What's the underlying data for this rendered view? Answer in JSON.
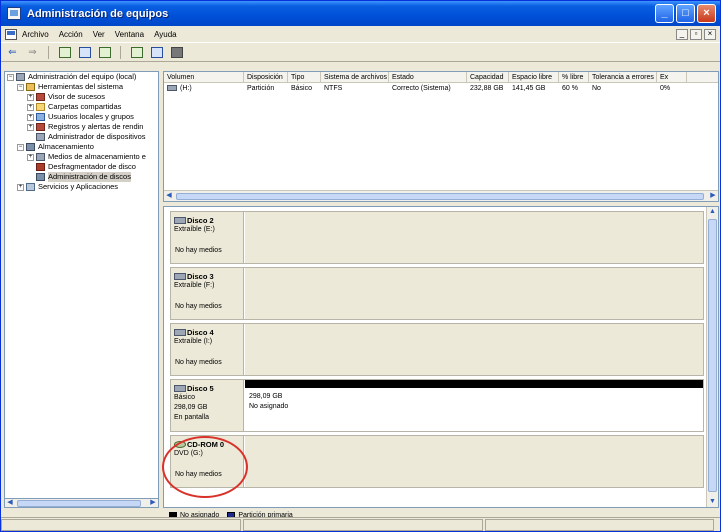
{
  "window": {
    "title": "Administración de equipos"
  },
  "menu": [
    "Archivo",
    "Acción",
    "Ver",
    "Ventana",
    "Ayuda"
  ],
  "mdi": {
    "minimize": "_",
    "restore": "▫",
    "close": "×"
  },
  "tree": {
    "items": [
      {
        "label": "Administración del equipo (local)",
        "expander": "−",
        "indent": 0,
        "icon": "computer-icon"
      },
      {
        "label": "Herramientas del sistema",
        "expander": "−",
        "indent": 1,
        "icon": "tools-icon"
      },
      {
        "label": "Visor de sucesos",
        "expander": "+",
        "indent": 2,
        "icon": "event-viewer-icon"
      },
      {
        "label": "Carpetas compartidas",
        "expander": "+",
        "indent": 2,
        "icon": "shared-folder-icon"
      },
      {
        "label": "Usuarios locales y grupos",
        "expander": "+",
        "indent": 2,
        "icon": "users-icon"
      },
      {
        "label": "Registros y alertas de rendin",
        "expander": "+",
        "indent": 2,
        "icon": "performance-logs-icon"
      },
      {
        "label": "Administrador de dispositivos",
        "expander": "",
        "indent": 2,
        "icon": "device-manager-icon"
      },
      {
        "label": "Almacenamiento",
        "expander": "−",
        "indent": 1,
        "icon": "storage-icon"
      },
      {
        "label": "Medios de almacenamiento e",
        "expander": "+",
        "indent": 2,
        "icon": "removable-storage-icon"
      },
      {
        "label": "Desfragmentador de disco",
        "expander": "",
        "indent": 2,
        "icon": "defrag-icon"
      },
      {
        "label": "Administración de discos",
        "expander": "",
        "indent": 2,
        "icon": "disk-management-icon",
        "selected": true
      },
      {
        "label": "Servicios y Aplicaciones",
        "expander": "+",
        "indent": 1,
        "icon": "services-icon"
      }
    ]
  },
  "volumes": {
    "columns": [
      "Volumen",
      "Disposición",
      "Tipo",
      "Sistema de archivos",
      "Estado",
      "Capacidad",
      "Espacio libre",
      "% libre",
      "Tolerancia a errores",
      "Ex"
    ],
    "rows": [
      [
        "(H:)",
        "Partición",
        "Básico",
        "NTFS",
        "Correcto (Sistema)",
        "232,88 GB",
        "141,45 GB",
        "60 %",
        "No",
        "0%"
      ]
    ]
  },
  "disks": [
    {
      "name": "Disco 2",
      "line1": "Extraíble (E:)",
      "line2": "",
      "line3": "",
      "media": "No hay medios",
      "type": "removable"
    },
    {
      "name": "Disco 3",
      "line1": "Extraíble (F:)",
      "line2": "",
      "line3": "",
      "media": "No hay medios",
      "type": "removable"
    },
    {
      "name": "Disco 4",
      "line1": "Extraíble (I:)",
      "line2": "",
      "line3": "",
      "media": "No hay medios",
      "type": "removable"
    },
    {
      "name": "Disco 5",
      "line1": "Básico",
      "line2": "298,09 GB",
      "line3": "En pantalla",
      "media": "",
      "type": "basic",
      "partition_size": "298,09 GB",
      "partition_label": "No asignado"
    },
    {
      "name": "CD-ROM 0",
      "line1": "DVD (G:)",
      "line2": "",
      "line3": "",
      "media": "No hay medios",
      "type": "cdrom"
    }
  ],
  "legend": {
    "unallocated": {
      "label": "No asignado",
      "color": "#000000"
    },
    "primary": {
      "label": "Partición primaria",
      "color": "#1c2a8c"
    }
  },
  "colors": {
    "titlebar": "#0050d8",
    "highlight_ring": "#d9322a"
  }
}
